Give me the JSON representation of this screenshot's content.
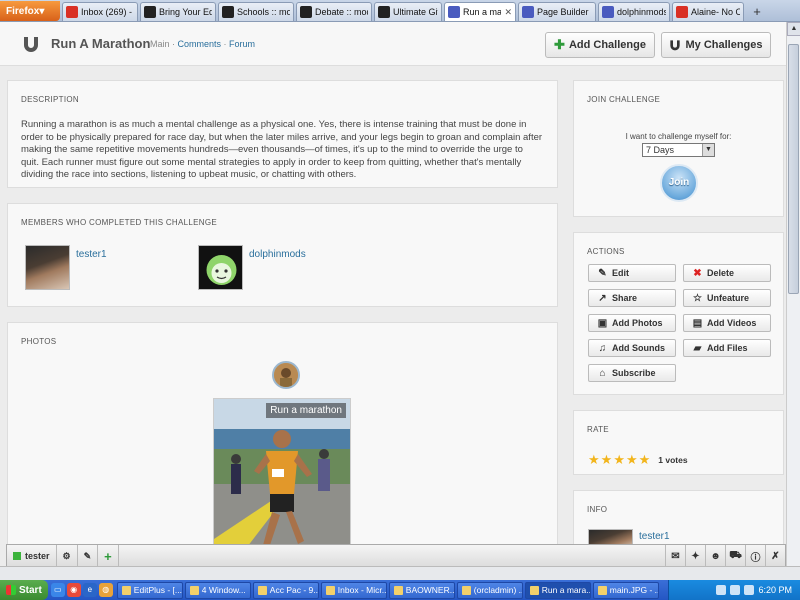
{
  "browser": {
    "menu_label": "Firefox",
    "tabs": [
      {
        "label": "Inbox (269) - ...",
        "color": "#d93025"
      },
      {
        "label": "Bring Your Edu...",
        "color": "#222222"
      },
      {
        "label": "Schools :: mod...",
        "color": "#222222"
      },
      {
        "label": "Debate :: mod...",
        "color": "#222222"
      },
      {
        "label": "Ultimate Gifts :...",
        "color": "#222222"
      },
      {
        "label": "Run a mara...",
        "color": "#4a5bbf",
        "active": true
      },
      {
        "label": "Page Builder",
        "color": "#4a5bbf"
      },
      {
        "label": "dolphinmods: I...",
        "color": "#4a5bbf"
      },
      {
        "label": "Alaine- No Ord...",
        "color": "#d93025"
      }
    ],
    "new_tab": "+"
  },
  "header": {
    "title": "Run A Marathon",
    "nav": [
      "Main",
      "Comments",
      "Forum"
    ],
    "add_challenge": "Add Challenge",
    "my_challenges": "My Challenges"
  },
  "description": {
    "title": "DESCRIPTION",
    "text": "Running a marathon is as much a mental challenge as a physical one. Yes, there is intense training that must be done in order to be physically prepared for  race day, but when the later miles arrive, and your legs begin to groan and complain after making the same repetitive movements hundreds—even thousands—of times, it's up to the mind to override the urge to quit. Each runner must figure out some mental strategies to apply in order to keep from quitting, whether that's mentally dividing the race into sections, listening to upbeat music, or chatting with others."
  },
  "members": {
    "title": "MEMBERS WHO COMPLETED THIS CHALLENGE",
    "list": [
      {
        "name": "tester1"
      },
      {
        "name": "dolphinmods"
      }
    ]
  },
  "photos": {
    "title": "PHOTOS",
    "caption": "Run a marathon"
  },
  "join": {
    "title": "JOIN CHALLENGE",
    "label": "I want to challenge myself for:",
    "selected": "7 Days",
    "button": "Join"
  },
  "actions": {
    "title": "ACTIONS",
    "buttons": [
      {
        "label": "Edit",
        "icon": "pencil-icon"
      },
      {
        "label": "Delete",
        "icon": "x-icon"
      },
      {
        "label": "Share",
        "icon": "share-icon"
      },
      {
        "label": "Unfeature",
        "icon": "star-outline-icon"
      },
      {
        "label": "Add Photos",
        "icon": "photo-icon"
      },
      {
        "label": "Add Videos",
        "icon": "film-icon"
      },
      {
        "label": "Add Sounds",
        "icon": "music-icon"
      },
      {
        "label": "Add Files",
        "icon": "file-icon"
      },
      {
        "label": "Subscribe",
        "icon": "tag-icon"
      }
    ]
  },
  "rate": {
    "title": "RATE",
    "stars": 5,
    "votes": "1 votes"
  },
  "info": {
    "title": "INFO",
    "user": "tester1"
  },
  "floatbar": {
    "user": "tester"
  },
  "taskbar": {
    "start": "Start",
    "tasks": [
      "EditPlus - [...",
      "4 Window...",
      "Acc Pac - 9...",
      "Inbox - Micr...",
      "BAOWNER...",
      "(orcladmin) ...",
      "Run a mara...",
      "main.JPG - ..."
    ],
    "active_index": 6,
    "time": "6:20 PM"
  }
}
